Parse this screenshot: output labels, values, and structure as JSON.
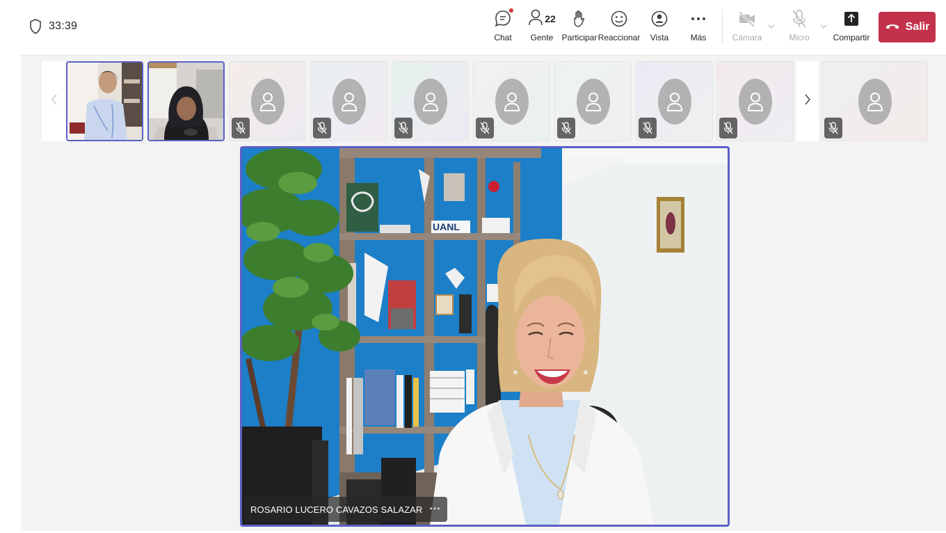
{
  "meeting": {
    "timer": "33:39"
  },
  "toolbar": {
    "chat_label": "Chat",
    "people_label": "Gente",
    "people_count": "22",
    "raise_label": "Participar",
    "react_label": "Reaccionar",
    "view_label": "Vista",
    "more_label": "Más",
    "camera_label": "Cámara",
    "mic_label": "Micro",
    "share_label": "Compartir",
    "leave_label": "Salir"
  },
  "colors": {
    "accent": "#5b5fc7",
    "leave": "#c4314b",
    "notification": "#d13438",
    "stage_bg": "#f3f3f3"
  },
  "gallery": {
    "video_tiles": 2,
    "avatar_tiles_muted": 9,
    "icons": [
      "chevron-left-icon",
      "chevron-right-icon",
      "person-avatar-icon",
      "mic-off-icon"
    ]
  },
  "main": {
    "speaker_name": "ROSARIO LUCERO CAVAZOS SALAZAR",
    "more_options": "···",
    "shelf_text": "UANL"
  }
}
